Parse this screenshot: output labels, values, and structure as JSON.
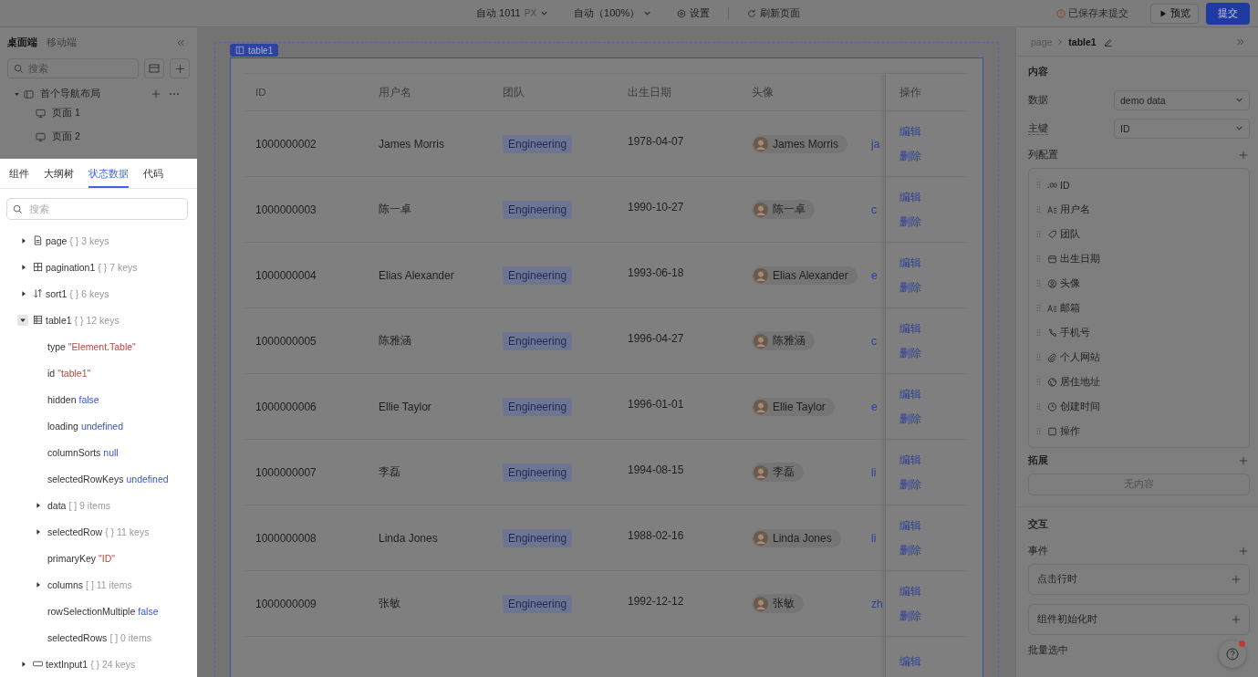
{
  "topbar": {
    "controls": [
      {
        "kind": "dropdown",
        "label": "自动 1011",
        "unit": "PX"
      },
      {
        "kind": "dropdown",
        "label": "自动（100%）"
      },
      {
        "kind": "settings",
        "label": "设置"
      },
      {
        "kind": "refresh",
        "label": "刷新页面"
      }
    ],
    "status": "已保存未提交",
    "preview": "预览",
    "submit": "提交"
  },
  "left": {
    "platform_tabs": [
      {
        "label": "桌面端",
        "selected": true
      },
      {
        "label": "移动端",
        "selected": false
      }
    ],
    "search": {
      "placeholder": "搜索"
    },
    "nav": {
      "label": "首个导航布局",
      "expanded": true,
      "children": [
        {
          "label": "页面 1"
        },
        {
          "label": "页面 2"
        }
      ]
    },
    "panel_tabs": [
      {
        "label": "组件",
        "selected": false
      },
      {
        "label": "大纲树",
        "selected": false
      },
      {
        "label": "状态数据",
        "selected": true
      },
      {
        "label": "代码",
        "selected": false
      }
    ],
    "state_search": {
      "placeholder": "搜索"
    },
    "state_tree": [
      {
        "kind": "branch",
        "name": "page",
        "type": "{ }",
        "summary": "3 keys",
        "expanded": false
      },
      {
        "kind": "branch",
        "name": "pagination1",
        "type": "{ }",
        "summary": "7 keys",
        "expanded": false
      },
      {
        "kind": "branch",
        "name": "sort1",
        "type": "{ }",
        "summary": "6 keys",
        "expanded": false
      },
      {
        "kind": "branch",
        "name": "table1",
        "type": "{ }",
        "summary": "12 keys",
        "expanded": true,
        "children": [
          {
            "kind": "string",
            "name": "type",
            "value": "\"Element.Table\""
          },
          {
            "kind": "string",
            "name": "id",
            "value": "\"table1\""
          },
          {
            "kind": "literal",
            "name": "hidden",
            "value": "false"
          },
          {
            "kind": "literal",
            "name": "loading",
            "value": "undefined"
          },
          {
            "kind": "literal",
            "name": "columnSorts",
            "value": "null"
          },
          {
            "kind": "literal",
            "name": "selectedRowKeys",
            "value": "undefined"
          },
          {
            "kind": "branch",
            "name": "data",
            "type": "[ ]",
            "summary": "9 items",
            "expanded": false
          },
          {
            "kind": "branch",
            "name": "selectedRow",
            "type": "{ }",
            "summary": "11 keys",
            "expanded": false
          },
          {
            "kind": "string",
            "name": "primaryKey",
            "value": "\"ID\""
          },
          {
            "kind": "branch",
            "name": "columns",
            "type": "[ ]",
            "summary": "11 items",
            "expanded": false
          },
          {
            "kind": "literal",
            "name": "rowSelectionMultiple",
            "value": "false"
          },
          {
            "kind": "summary",
            "name": "selectedRows",
            "value": "[ ] 0 items"
          }
        ]
      },
      {
        "kind": "branch",
        "name": "textInput1",
        "type": "{ }",
        "summary": "24 keys",
        "expanded": false
      }
    ]
  },
  "canvas": {
    "component_label": "table1",
    "table": {
      "columns": [
        "ID",
        "用户名",
        "团队",
        "出生日期",
        "头像"
      ],
      "action_header": "操作",
      "rows": [
        {
          "id": "1000000002",
          "username": "James Morris",
          "team": "Engineering",
          "birth_date": "1978-04-07",
          "avatar_name": "James Morris",
          "email": "ja",
          "actions": [
            "编辑",
            "删除"
          ]
        },
        {
          "id": "1000000003",
          "username": "陈一卓",
          "team": "Engineering",
          "birth_date": "1990-10-27",
          "avatar_name": "陈一卓",
          "email": "c",
          "actions": [
            "编辑",
            "删除"
          ]
        },
        {
          "id": "1000000004",
          "username": "Elias Alexander",
          "team": "Engineering",
          "birth_date": "1993-06-18",
          "avatar_name": "Elias Alexander",
          "email": "e",
          "actions": [
            "编辑",
            "删除"
          ]
        },
        {
          "id": "1000000005",
          "username": "陈雅涵",
          "team": "Engineering",
          "birth_date": "1996-04-27",
          "avatar_name": "陈雅涵",
          "email": "c",
          "actions": [
            "编辑",
            "删除"
          ]
        },
        {
          "id": "1000000006",
          "username": "Ellie Taylor",
          "team": "Engineering",
          "birth_date": "1996-01-01",
          "avatar_name": "Ellie Taylor",
          "email": "e",
          "actions": [
            "编辑",
            "删除"
          ]
        },
        {
          "id": "1000000007",
          "username": "李磊",
          "team": "Engineering",
          "birth_date": "1994-08-15",
          "avatar_name": "李磊",
          "email": "li",
          "actions": [
            "编辑",
            "删除"
          ]
        },
        {
          "id": "1000000008",
          "username": "Linda Jones",
          "team": "Engineering",
          "birth_date": "1988-02-16",
          "avatar_name": "Linda Jones",
          "email": "li",
          "actions": [
            "编辑",
            "删除"
          ]
        },
        {
          "id": "1000000009",
          "username": "张敏",
          "team": "Engineering",
          "birth_date": "1992-12-12",
          "avatar_name": "张敏",
          "email": "zh",
          "actions": [
            "编辑",
            "删除"
          ]
        }
      ],
      "partial_row_action": "编辑"
    }
  },
  "right": {
    "breadcrumb": [
      "page",
      "table1"
    ],
    "content": {
      "title": "内容",
      "fields": [
        {
          "label": "数据",
          "value": "demo data"
        },
        {
          "label": "主键",
          "value": "ID"
        }
      ],
      "columns_title": "列配置",
      "columns": [
        "ID",
        "用户名",
        "团队",
        "出生日期",
        "头像",
        "邮箱",
        "手机号",
        "个人网站",
        "居住地址",
        "创建时间",
        "操作"
      ],
      "extend_title": "拓展",
      "extend_empty": "无内容"
    },
    "interaction": {
      "title": "交互",
      "events_title": "事件",
      "events": [
        "点击行时",
        "组件初始化时"
      ],
      "batch_select": "批量选中"
    }
  },
  "help": {
    "has_notification": true
  }
}
